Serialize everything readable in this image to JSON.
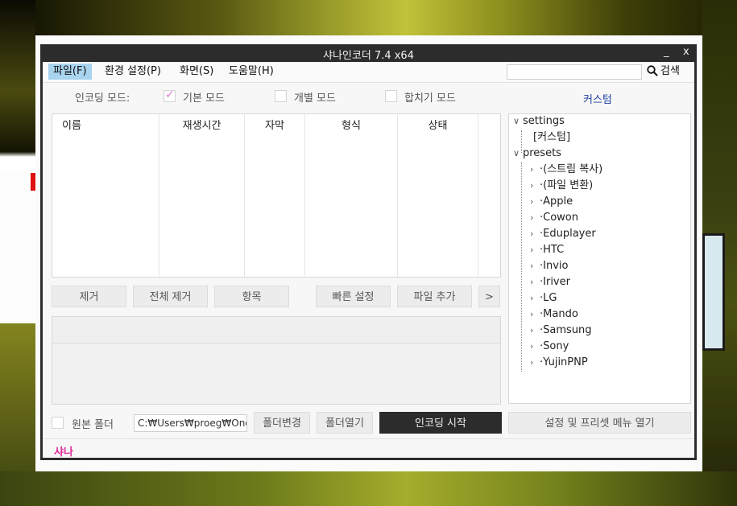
{
  "window": {
    "title": "샤나인코더  7.4  x64",
    "minimize": "_",
    "close": "x"
  },
  "menu": {
    "file": "파일(F)",
    "settings": "환경 설정(P)",
    "view": "화면(S)",
    "help": "도움말(H)",
    "search_label": "검색",
    "search_value": ""
  },
  "mode": {
    "label": "인코딩 모드:",
    "basic": "기본 모드",
    "basic_checked": true,
    "individual": "개별 모드",
    "individual_checked": false,
    "merge": "합치기 모드",
    "merge_checked": false,
    "custom_link": "커스텀"
  },
  "filelist": {
    "columns": [
      "이름",
      "재생시간",
      "자막",
      "형식",
      "상태"
    ],
    "rows": []
  },
  "buttons": {
    "remove": "제거",
    "remove_all": "전체 제거",
    "items": "항목",
    "quick_settings": "빠른 설정",
    "add_file": "파일 추가",
    "more": ">",
    "change_folder": "폴더변경",
    "open_folder": "폴더열기",
    "start_encoding": "인코딩 시작",
    "open_settings_menu": "설정 및 프리셋 메뉴 열기"
  },
  "output": {
    "source_folder_label": "원본 폴더",
    "source_folder_checked": false,
    "path": "C:₩Users₩proeg₩OneDrive"
  },
  "tree": {
    "settings_label": "settings",
    "settings_children": [
      "[커스텀]"
    ],
    "presets_label": "presets",
    "presets_children": [
      "(스트림 복사)",
      "(파일 변환)",
      "Apple",
      "Cowon",
      "Eduplayer",
      "HTC",
      "Invio",
      "Iriver",
      "LG",
      "Mando",
      "Samsung",
      "Sony",
      "YujinPNP"
    ]
  },
  "status": {
    "text": "샤나"
  },
  "colors": {
    "titlebar": "#2c2c2c",
    "menu_active": "#a9d4ef",
    "status_text": "#e0289a",
    "link": "#1d3fa0",
    "check_mark": "#d97ad2"
  }
}
